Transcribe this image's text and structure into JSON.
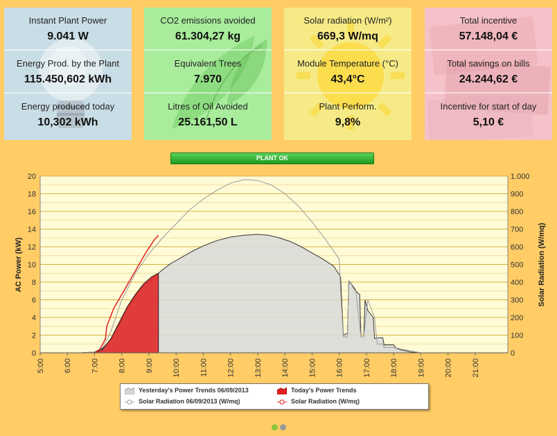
{
  "panels": [
    {
      "color": "#c9dde6",
      "icon": "light-bulb-icon",
      "rows": [
        {
          "label": "Instant Plant Power",
          "value": "9.041 W"
        },
        {
          "label": "Energy Prod. by the Plant",
          "value": "115.450,602 kWh"
        },
        {
          "label": "Energy produced today",
          "value": "10,302 kWh"
        }
      ]
    },
    {
      "color": "#a8ec9c",
      "icon": "leaf-icon",
      "rows": [
        {
          "label": "CO2 emissions avoided",
          "value": "61.304,27 kg"
        },
        {
          "label": "Equivalent Trees",
          "value": "7.970"
        },
        {
          "label": "Litres of Oil Avoided",
          "value": "25.161,50 L"
        }
      ]
    },
    {
      "color": "#f6ea86",
      "icon": "sun-icon",
      "rows": [
        {
          "label": "Solar radiation (W/m²)",
          "value": "669,3 W/mq"
        },
        {
          "label": "Module Temperature (°C)",
          "value": "43,4°C"
        },
        {
          "label": "Plant Perform.",
          "value": "9,8%"
        }
      ]
    },
    {
      "color": "#f4c2c8",
      "icon": "euro-banknotes-icon",
      "rows": [
        {
          "label": "Total incentive",
          "value": "57.148,04 €"
        },
        {
          "label": "Total savings on bills",
          "value": "24.244,62 €"
        },
        {
          "label": "Incentive for start of day",
          "value": "5,10 €"
        }
      ]
    }
  ],
  "status": {
    "label": "PLANT OK",
    "color": "#2fb52f"
  },
  "chart_data": {
    "type": "area",
    "xlabel": "",
    "ylabel": "AC Power (kW)",
    "ylabel_right": "Solar Radiation (W/mq)",
    "ylim": [
      0,
      20
    ],
    "ylim_right": [
      0,
      1000
    ],
    "x_ticks": [
      "5:00",
      "6:00",
      "7:00",
      "8:00",
      "9:00",
      "10:00",
      "11:00",
      "12:00",
      "13:00",
      "14:00",
      "15:00",
      "16:00",
      "17:00",
      "18:00",
      "19:00",
      "20:00",
      "21:00"
    ],
    "y_ticks": [
      "0",
      "2",
      "4",
      "6",
      "8",
      "10",
      "12",
      "14",
      "16",
      "18",
      "20"
    ],
    "y_ticks_right": [
      "0",
      "100",
      "200",
      "300",
      "400",
      "500",
      "600",
      "700",
      "800",
      "900",
      "1.000"
    ],
    "grid": true,
    "legend_position": "bottom",
    "series": [
      {
        "name": "Yesterday's Power Trends 06/09/2013",
        "axis": "left",
        "color": "#d9d9d9",
        "x": [
          5.0,
          6.5,
          7.0,
          7.3,
          7.6,
          7.9,
          8.2,
          8.5,
          8.8,
          9.2,
          9.5,
          9.8,
          10.2,
          10.6,
          11.0,
          11.5,
          12.0,
          12.5,
          13.0,
          13.4,
          13.8,
          14.2,
          14.6,
          15.0,
          15.4,
          15.8,
          16.05,
          16.15,
          16.3,
          16.35,
          16.4,
          16.6,
          16.75,
          16.8,
          16.9,
          16.95,
          17.05,
          17.25,
          17.3,
          17.4,
          17.6,
          17.65,
          18.0,
          18.1,
          18.3,
          18.5,
          18.6,
          19.0,
          19.5,
          20.0,
          20.5
        ],
        "values": [
          0,
          0,
          0.1,
          0.5,
          1.5,
          3.2,
          5.0,
          6.5,
          7.6,
          8.6,
          9.4,
          10.1,
          10.8,
          11.5,
          12.1,
          12.7,
          13.1,
          13.3,
          13.4,
          13.3,
          13.0,
          12.6,
          12.0,
          11.3,
          10.6,
          9.8,
          8.6,
          2.0,
          2.2,
          7.8,
          8.0,
          7.0,
          6.6,
          1.8,
          1.8,
          6.0,
          4.8,
          4.0,
          1.6,
          1.7,
          1.7,
          0.9,
          0.9,
          0.5,
          0.3,
          0.2,
          0.1,
          0,
          0,
          0,
          0
        ]
      },
      {
        "name": "Today's Power Trends",
        "axis": "left",
        "color": "#e02020",
        "x": [
          7.0,
          7.3,
          7.6,
          7.9,
          8.2,
          8.5,
          8.8,
          9.1,
          9.35
        ],
        "values": [
          0,
          0.4,
          1.6,
          3.4,
          5.2,
          6.6,
          7.8,
          8.6,
          9.0
        ]
      },
      {
        "name": "Solar Radiation 06/09/2013 (W/mq)",
        "axis": "right",
        "color": "#9a9a9a",
        "x": [
          5.0,
          6.5,
          7.0,
          7.3,
          7.6,
          8.0,
          8.5,
          9.0,
          9.5,
          10.0,
          10.5,
          11.0,
          11.5,
          12.0,
          12.5,
          13.0,
          13.5,
          14.0,
          14.5,
          15.0,
          15.5,
          16.0,
          16.05,
          16.15,
          16.3,
          16.35,
          16.6,
          16.8,
          16.9,
          17.05,
          17.3,
          17.4,
          17.6,
          17.65,
          18.0,
          18.5,
          19.0,
          19.5
        ],
        "values": [
          0,
          0,
          5,
          30,
          120,
          300,
          450,
          560,
          650,
          730,
          810,
          870,
          920,
          960,
          980,
          975,
          950,
          900,
          830,
          740,
          640,
          530,
          350,
          90,
          90,
          410,
          360,
          90,
          90,
          300,
          200,
          50,
          50,
          30,
          30,
          15,
          0,
          0
        ]
      },
      {
        "name": "Solar Radiation (W/mq)",
        "axis": "right",
        "color": "#e02020",
        "x": [
          7.0,
          7.2,
          7.4,
          7.45,
          7.7,
          8.0,
          8.3,
          8.6,
          8.9,
          9.2,
          9.35
        ],
        "values": [
          0,
          20,
          80,
          150,
          250,
          330,
          410,
          490,
          570,
          640,
          665
        ]
      }
    ]
  },
  "legend": [
    {
      "label": "Yesterday's Power Trends 06/09/2013",
      "icon": "grey-area-icon"
    },
    {
      "label": "Today's Power Trends",
      "icon": "red-area-icon"
    },
    {
      "label": "Solar Radiation 06/09/2013 (W/mq)",
      "icon": "grey-line-marker-icon"
    },
    {
      "label": "Solar Radiation (W/mq)",
      "icon": "red-line-marker-icon"
    }
  ],
  "pager": [
    {
      "icon": "page-dot-active-icon",
      "color": "#8cc63f"
    },
    {
      "icon": "page-dot-icon",
      "color": "#9a9a9a"
    }
  ]
}
